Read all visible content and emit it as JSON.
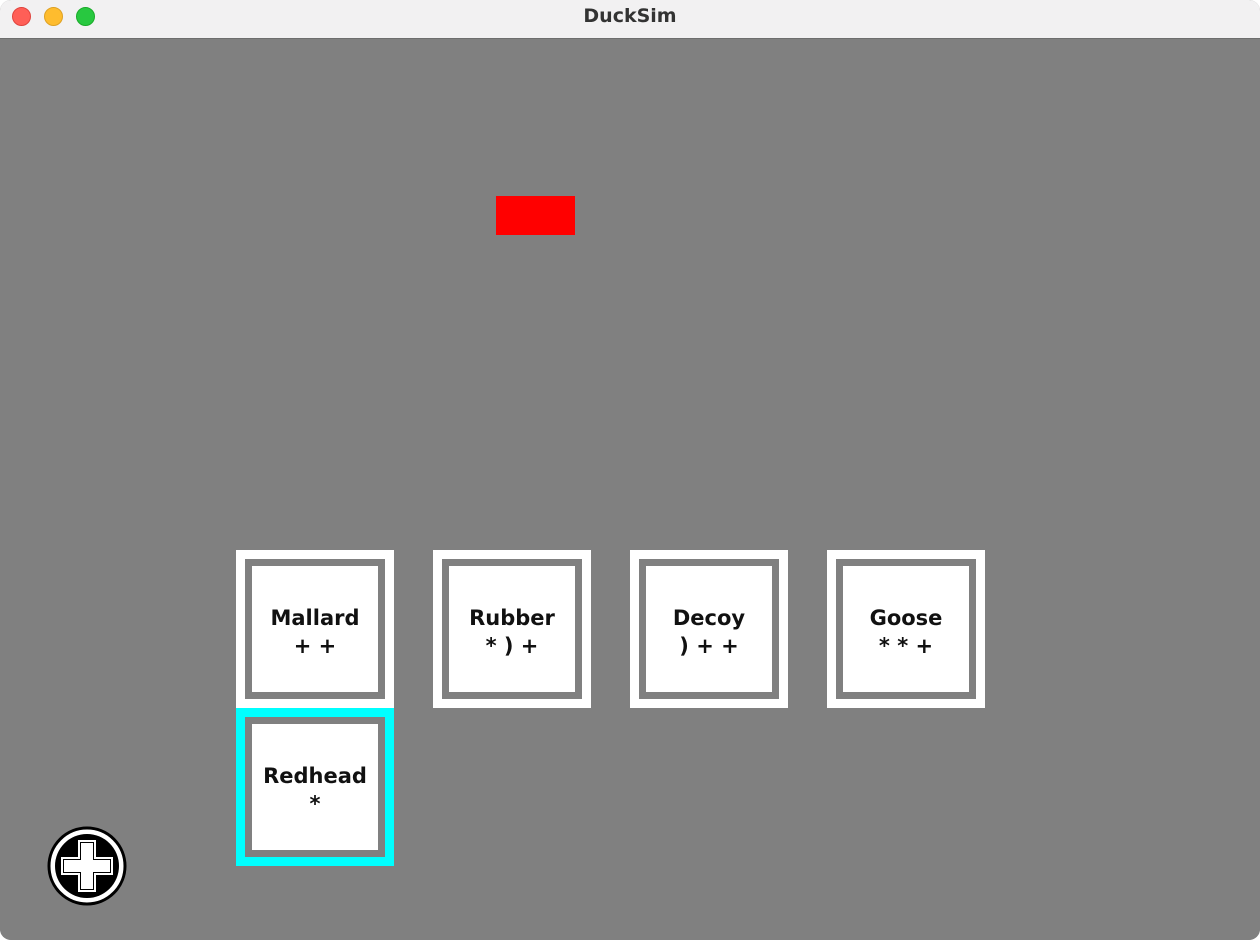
{
  "window": {
    "title": "DuckSim"
  },
  "colors": {
    "canvas_bg": "#808080",
    "tile_bg": "#ffffff",
    "tile_border": "#808080",
    "selected_outline": "#00ffff",
    "marker": "#ff0000"
  },
  "marker": {
    "name": "red-rectangle"
  },
  "ducks": [
    {
      "name": "Mallard",
      "symbols": "+ +",
      "selected": false
    },
    {
      "name": "Rubber",
      "symbols": "* ) +",
      "selected": false
    },
    {
      "name": "Decoy",
      "symbols": ") + +",
      "selected": false
    },
    {
      "name": "Goose",
      "symbols": "* * +",
      "selected": false
    },
    {
      "name": "Redhead",
      "symbols": "*",
      "selected": true
    }
  ],
  "add_button": {
    "icon": "plus-circle-icon"
  }
}
